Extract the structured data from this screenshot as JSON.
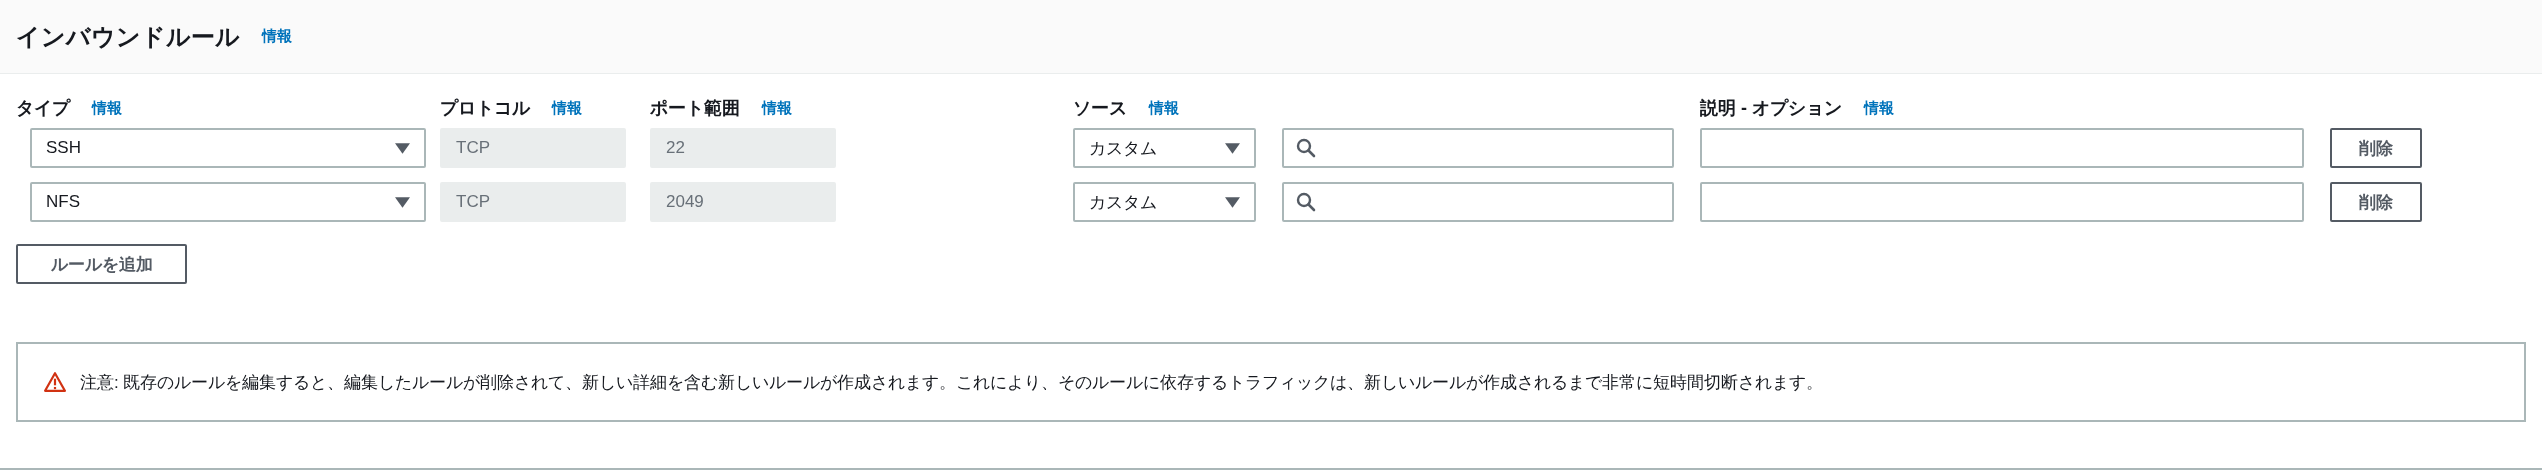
{
  "header": {
    "title": "インバウンドルール",
    "info": "情報"
  },
  "columns": [
    {
      "label": "タイプ",
      "info": "情報"
    },
    {
      "label": "プロトコル",
      "info": "情報"
    },
    {
      "label": "ポート範囲",
      "info": "情報"
    },
    {
      "label": "ソース",
      "info": "情報"
    },
    {
      "label": "説明 - オプション",
      "info": "情報"
    }
  ],
  "rules": [
    {
      "type": "SSH",
      "protocol": {
        "value": "TCP",
        "disabled": true
      },
      "port": {
        "value": "22",
        "disabled": true
      },
      "source": "カスタム",
      "delete": "削除"
    },
    {
      "type": "NFS",
      "protocol": {
        "value": "TCP",
        "disabled": true
      },
      "port": {
        "value": "2049",
        "disabled": true
      },
      "source": "カスタム",
      "delete": "削除"
    }
  ],
  "add_button": "ルールを追加",
  "warning": "注意: 既存のルールを編集すると、編集したルールが削除されて、新しい詳細を含む新しいルールが作成されます。これにより、そのルールに依存するトラフィックは、新しいルールが作成されるまで非常に短時間切断されます。"
}
